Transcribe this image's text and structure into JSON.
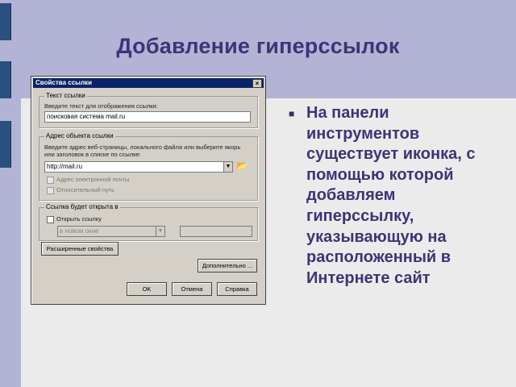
{
  "slide": {
    "title": "Добавление гиперссылок",
    "bullet": "На панели инструментов существует иконка, с помощью которой добавляем гиперссылку, указывающую на расположенный в Интернете сайт"
  },
  "dialog": {
    "title": "Свойства ссылки",
    "close": "×",
    "link_text_group": {
      "legend": "Текст ссылки",
      "label": "Введите текст для отображения ссылки:",
      "value": "поисковая система mail.ru"
    },
    "address_group": {
      "legend": "Адрес объекта ссылки",
      "instruction_line1": "Введите адрес веб-страницы, локального файла или выберите якорь",
      "instruction_line2": "или заголовок в списке по ссылке:",
      "url_value": "http://mail.ru",
      "email_checkbox": "Адрес электронной почты",
      "relative_checkbox": "Относительный путь"
    },
    "target_group": {
      "legend": "Ссылка будет открыта в",
      "new_window_checkbox": "Открыть ссылку",
      "target_value": "в новом окне"
    },
    "buttons": {
      "extended": "Расширенные свойства",
      "additional": "Дополнительно ...",
      "ok": "OK",
      "cancel": "Отмена",
      "help": "Справка"
    }
  }
}
